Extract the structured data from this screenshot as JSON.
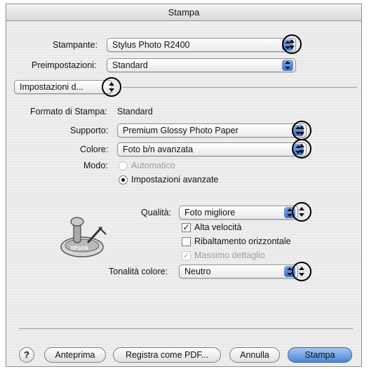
{
  "window": {
    "title": "Stampa"
  },
  "printer": {
    "label": "Stampante:",
    "value": "Stylus Photo R2400"
  },
  "presets": {
    "label": "Preimpostazioni:",
    "value": "Standard"
  },
  "panel": {
    "value": "Impostazioni d..."
  },
  "format": {
    "label": "Formato di Stampa:",
    "value": "Standard"
  },
  "media": {
    "label": "Supporto:",
    "value": "Premium Glossy Photo Paper"
  },
  "color": {
    "label": "Colore:",
    "value": "Foto b/n avanzata"
  },
  "mode": {
    "label": "Modo:",
    "options": [
      "Automatico",
      "Impostazioni avanzate"
    ],
    "selected": "Impostazioni avanzate"
  },
  "quality": {
    "label": "Qualità:",
    "value": "Foto migliore"
  },
  "checkboxes": {
    "high_speed": {
      "label": "Alta velocità",
      "checked": true,
      "enabled": true
    },
    "flip_horizontal": {
      "label": "Ribaltamento orizzontale",
      "checked": false,
      "enabled": true
    },
    "finest_detail": {
      "label": "Massimo dettaglio",
      "checked": true,
      "enabled": false
    }
  },
  "tone": {
    "label": "Tonalità colore:",
    "value": "Neutro"
  },
  "icon": {
    "name": "epson-printer-icon",
    "text": "EPSON"
  },
  "buttons": {
    "help": "?",
    "preview": "Anteprima",
    "save_pdf": "Registra come PDF...",
    "cancel": "Annulla",
    "print": "Stampa"
  },
  "colors": {
    "accent": "#4a86d8",
    "callout_ring": "#000000"
  }
}
